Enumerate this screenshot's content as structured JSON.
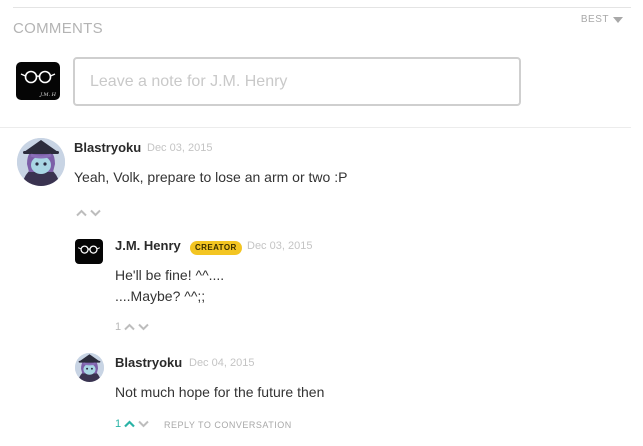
{
  "header": {
    "title": "COMMENTS",
    "sort_label": "BEST"
  },
  "composer": {
    "placeholder": "Leave a note for J.M. Henry",
    "avatar_signature": "J.M. H"
  },
  "comments": [
    {
      "author": "Blastryoku",
      "date": "Dec 03, 2015",
      "lines": [
        "Yeah, Volk, prepare to lose an arm or two :P"
      ],
      "vote_count": ""
    },
    {
      "author": "J.M. Henry",
      "badge": "CREATOR",
      "date": "Dec 03, 2015",
      "lines": [
        "He'll be fine! ^^....",
        "....Maybe? ^^;;"
      ],
      "vote_count": "1"
    },
    {
      "author": "Blastryoku",
      "date": "Dec 04, 2015",
      "lines": [
        "Not much hope for the future then"
      ],
      "vote_count": "1",
      "reply_label": "REPLY TO CONVERSATION"
    }
  ],
  "colors": {
    "accent": "#2ab3a6",
    "badge": "#f3c522",
    "muted": "#b8b8b8"
  }
}
